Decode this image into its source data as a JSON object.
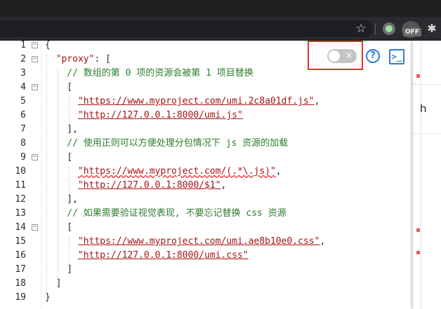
{
  "toolbar": {
    "star_glyph": "☆",
    "puzzle_glyph": "✱",
    "off_badge": "OFF"
  },
  "background_page": {
    "snippet": "h"
  },
  "popup": {
    "toggle_glyph": "×",
    "help_glyph": "?",
    "terminal_glyph": ">_"
  },
  "editor": {
    "lines": [
      {
        "n": "1",
        "segs": [
          {
            "t": "{",
            "c": "pun"
          }
        ],
        "fold": "−"
      },
      {
        "n": "2",
        "segs": [
          {
            "t": "  \"proxy\"",
            "c": "key"
          },
          {
            "t": ": [",
            "c": "pun"
          }
        ],
        "fold": "−"
      },
      {
        "n": "3",
        "segs": [
          {
            "t": "    // 数组的第 0 项的资源会被第 1 项目替换",
            "c": "cmt"
          }
        ],
        "fold": ""
      },
      {
        "n": "4",
        "segs": [
          {
            "t": "    [",
            "c": "pun"
          }
        ],
        "fold": "−"
      },
      {
        "n": "5",
        "segs": [
          {
            "t": "      ",
            "c": "pun"
          },
          {
            "t": "\"https://www.myproject.com/umi.2c8a01df.js\"",
            "c": "url"
          },
          {
            "t": ",",
            "c": "pun"
          }
        ],
        "fold": ""
      },
      {
        "n": "6",
        "segs": [
          {
            "t": "      ",
            "c": "pun"
          },
          {
            "t": "\"http://127.0.0.1:8000/umi.js\"",
            "c": "url"
          }
        ],
        "fold": ""
      },
      {
        "n": "7",
        "segs": [
          {
            "t": "    ],",
            "c": "pun"
          }
        ],
        "fold": ""
      },
      {
        "n": "8",
        "segs": [
          {
            "t": "    // 使用正则可以方便处理分包情况下 js 资源的加载",
            "c": "cmt"
          }
        ],
        "fold": ""
      },
      {
        "n": "9",
        "segs": [
          {
            "t": "    [",
            "c": "pun"
          }
        ],
        "fold": "−"
      },
      {
        "n": "10",
        "segs": [
          {
            "t": "      ",
            "c": "pun"
          },
          {
            "t": "\"https://www.myproject.com/(.*\\.js)\"",
            "c": "wavy"
          },
          {
            "t": ",",
            "c": "pun"
          }
        ],
        "fold": ""
      },
      {
        "n": "11",
        "segs": [
          {
            "t": "      ",
            "c": "pun"
          },
          {
            "t": "\"http://127.0.0.1:8000/$1\"",
            "c": "url"
          },
          {
            "t": ",",
            "c": "pun"
          }
        ],
        "fold": ""
      },
      {
        "n": "12",
        "segs": [
          {
            "t": "    ],",
            "c": "pun"
          }
        ],
        "fold": ""
      },
      {
        "n": "13",
        "segs": [
          {
            "t": "    // 如果需要验证视觉表现, 不要忘记替换 css 资源",
            "c": "cmt"
          }
        ],
        "fold": ""
      },
      {
        "n": "14",
        "segs": [
          {
            "t": "    [",
            "c": "pun"
          }
        ],
        "fold": "−"
      },
      {
        "n": "15",
        "segs": [
          {
            "t": "      ",
            "c": "pun"
          },
          {
            "t": "\"https://www.myproject.com/umi.ae8b10e0.css\"",
            "c": "url"
          },
          {
            "t": ",",
            "c": "pun"
          }
        ],
        "fold": ""
      },
      {
        "n": "16",
        "segs": [
          {
            "t": "      ",
            "c": "pun"
          },
          {
            "t": "\"http://127.0.0.1:8000/umi.css\"",
            "c": "url"
          }
        ],
        "fold": ""
      },
      {
        "n": "17",
        "segs": [
          {
            "t": "    ]",
            "c": "pun"
          }
        ],
        "fold": ""
      },
      {
        "n": "18",
        "segs": [
          {
            "t": "  ]",
            "c": "pun"
          }
        ],
        "fold": ""
      },
      {
        "n": "19",
        "segs": [
          {
            "t": "}",
            "c": "pun"
          }
        ],
        "fold": ""
      }
    ]
  }
}
